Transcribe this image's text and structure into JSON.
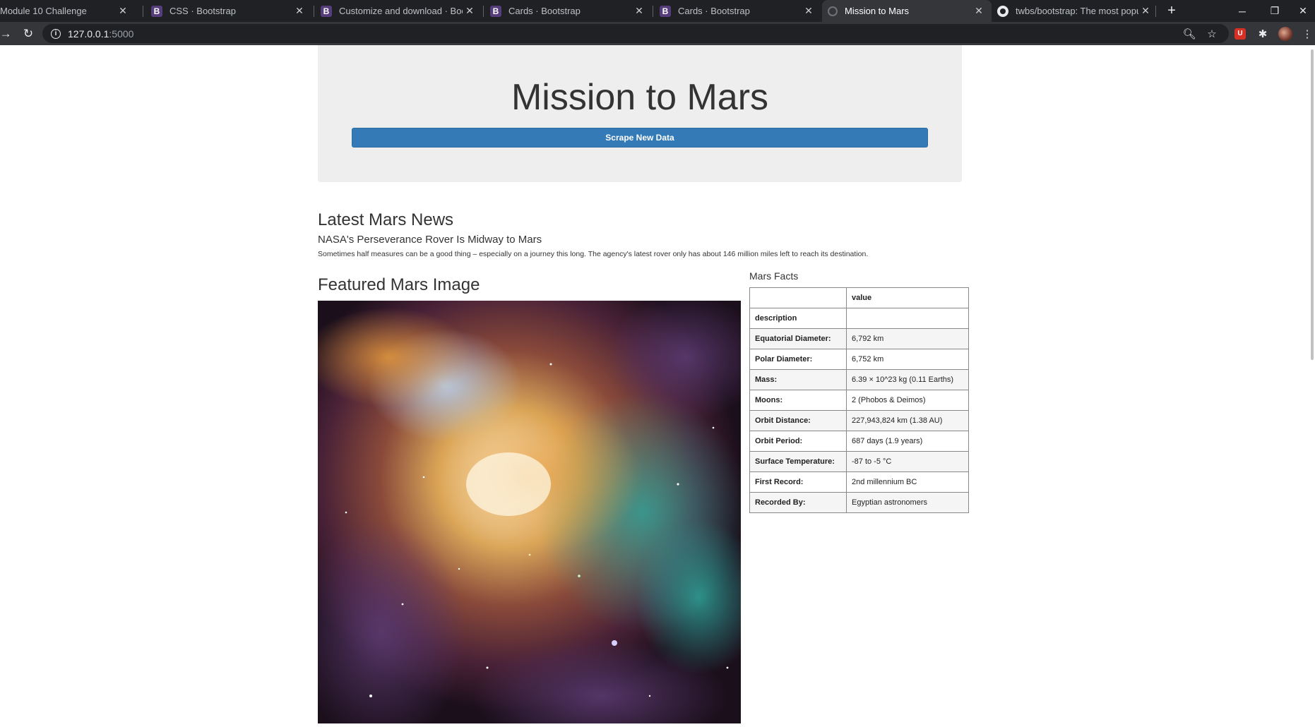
{
  "browser": {
    "tabs": [
      {
        "title": "Module 10 Challenge",
        "favicon": "none",
        "active": false
      },
      {
        "title": "CSS · Bootstrap",
        "favicon": "bootstrap-icon",
        "active": false
      },
      {
        "title": "Customize and download · Boots",
        "favicon": "bootstrap-icon",
        "active": false
      },
      {
        "title": "Cards · Bootstrap",
        "favicon": "bootstrap-icon",
        "active": false
      },
      {
        "title": "Cards · Bootstrap",
        "favicon": "bootstrap-icon",
        "active": false
      },
      {
        "title": "Mission to Mars",
        "favicon": "globe-icon",
        "active": true
      },
      {
        "title": "twbs/bootstrap: The most popul",
        "favicon": "github-icon",
        "active": false
      }
    ],
    "url_host": "127.0.0.1",
    "url_port": ":5000"
  },
  "page": {
    "title": "Mission to Mars",
    "scrape_button": "Scrape New Data",
    "news": {
      "heading": "Latest Mars News",
      "title": "NASA's Perseverance Rover Is Midway to Mars",
      "paragraph": "Sometimes half measures can be a good thing – especially on a journey this long. The agency's latest rover only has about 146 million miles left to reach its destination."
    },
    "featured": {
      "heading": "Featured Mars Image"
    },
    "facts": {
      "heading": "Mars Facts",
      "header_col": "value",
      "header_row_label": "description",
      "rows": [
        {
          "label": "Equatorial Diameter:",
          "value": "6,792 km"
        },
        {
          "label": "Polar Diameter:",
          "value": "6,752 km"
        },
        {
          "label": "Mass:",
          "value": "6.39 × 10^23 kg (0.11 Earths)"
        },
        {
          "label": "Moons:",
          "value": "2 (Phobos & Deimos)"
        },
        {
          "label": "Orbit Distance:",
          "value": "227,943,824 km (1.38 AU)"
        },
        {
          "label": "Orbit Period:",
          "value": "687 days (1.9 years)"
        },
        {
          "label": "Surface Temperature:",
          "value": "-87 to -5 °C"
        },
        {
          "label": "First Record:",
          "value": "2nd millennium BC"
        },
        {
          "label": "Recorded By:",
          "value": "Egyptian astronomers"
        }
      ]
    }
  }
}
